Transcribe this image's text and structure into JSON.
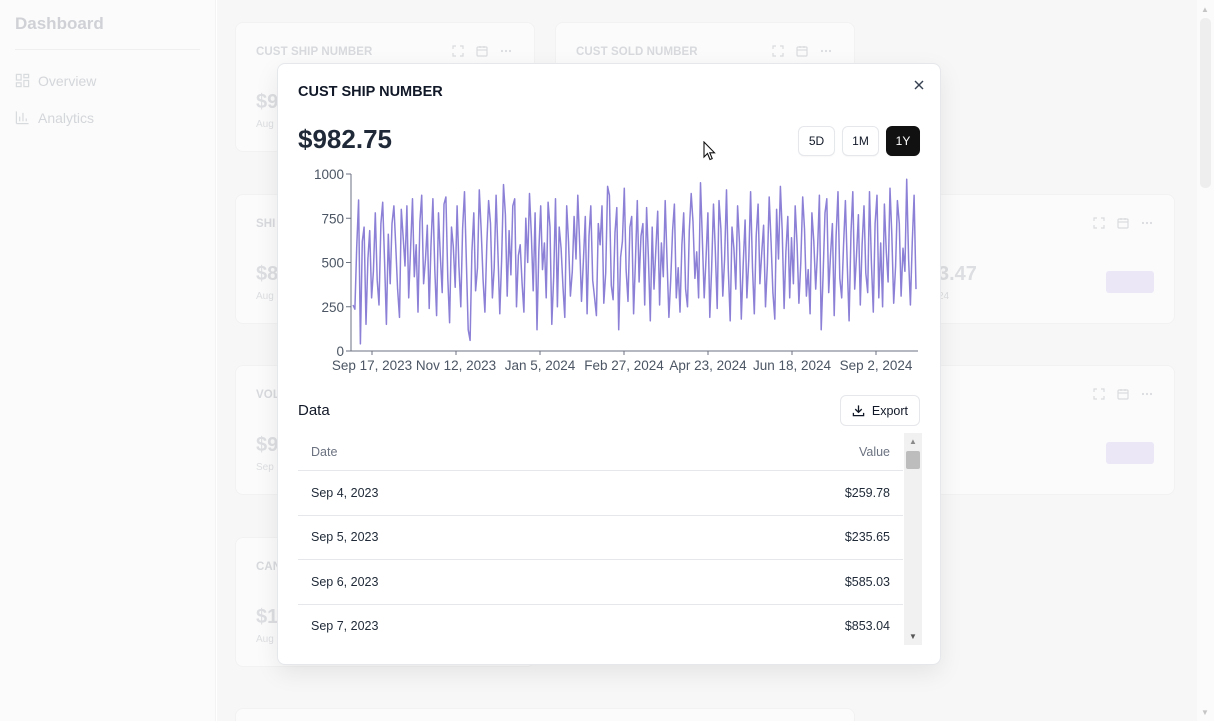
{
  "sidebar": {
    "title": "Dashboard",
    "items": [
      {
        "label": "Overview",
        "icon": "grid-icon"
      },
      {
        "label": "Analytics",
        "icon": "bar-chart-icon"
      }
    ]
  },
  "background_cards": [
    {
      "title": "CUST SHIP NUMBER",
      "value": "$9",
      "sub": "Aug"
    },
    {
      "title": "CUST SOLD NUMBER"
    },
    {
      "title": "SHI",
      "value": "$8",
      "sub": "Aug"
    },
    {
      "title": "VOL",
      "value": "$9",
      "sub": "Sep"
    },
    {
      "title": "CAN",
      "value": "$1",
      "sub": "Aug"
    },
    {
      "value_right": "3.47",
      "sub_right": "24"
    }
  ],
  "modal": {
    "title": "CUST SHIP NUMBER",
    "close_label": "×",
    "value": "$982.75",
    "ranges": [
      "5D",
      "1M",
      "1Y"
    ],
    "active_range": "1Y",
    "data_title": "Data",
    "export_label": "Export",
    "table": {
      "headers": [
        "Date",
        "Value"
      ],
      "rows": [
        [
          "Sep 4, 2023",
          "$259.78"
        ],
        [
          "Sep 5, 2023",
          "$235.65"
        ],
        [
          "Sep 6, 2023",
          "$585.03"
        ],
        [
          "Sep 7, 2023",
          "$853.04"
        ]
      ]
    }
  },
  "colors": {
    "line": "#8b80d6",
    "active_button": "#111111",
    "spark": "#e6e2f6"
  },
  "chart_data": {
    "type": "line",
    "title": "",
    "xlabel": "",
    "ylabel": "",
    "ylim": [
      0,
      1000
    ],
    "yticks": [
      0,
      250,
      500,
      750,
      1000
    ],
    "xtick_labels": [
      "Sep 17, 2023",
      "Nov 12, 2023",
      "Jan 5, 2024",
      "Feb 27, 2024",
      "Apr 23, 2024",
      "Jun 18, 2024",
      "Sep 2, 2024"
    ],
    "x_start": "Sep 4, 2023",
    "x_end": "Sep 6, 2024",
    "series": [
      {
        "values": [
          260,
          236,
          585,
          853,
          40,
          620,
          700,
          150,
          520,
          680,
          300,
          450,
          780,
          400,
          260,
          720,
          840,
          500,
          150,
          660,
          380,
          720,
          820,
          600,
          350,
          190,
          800,
          640,
          480,
          820,
          300,
          580,
          860,
          420,
          600,
          220,
          730,
          880,
          380,
          520,
          710,
          240,
          600,
          860,
          460,
          200,
          780,
          540,
          330,
          830,
          870,
          410,
          160,
          700,
          590,
          360,
          820,
          480,
          250,
          690,
          900,
          520,
          120,
          60,
          560,
          780,
          340,
          470,
          910,
          680,
          400,
          220,
          600,
          850,
          720,
          300,
          470,
          880,
          560,
          210,
          510,
          940,
          770,
          310,
          680,
          430,
          820,
          860,
          250,
          540,
          600,
          380,
          220,
          750,
          500,
          890,
          650,
          340,
          780,
          120,
          560,
          820,
          460,
          610,
          300,
          840,
          700,
          150,
          420,
          860,
          250,
          700,
          580,
          360,
          190,
          820,
          620,
          310,
          450,
          760,
          520,
          880,
          600,
          280,
          510,
          760,
          210,
          650,
          820,
          400,
          300,
          200,
          720,
          600,
          820,
          270,
          440,
          930,
          880,
          370,
          290,
          670,
          810,
          120,
          530,
          620,
          920,
          460,
          280,
          700,
          760,
          210,
          500,
          850,
          390,
          650,
          720,
          260,
          810,
          530,
          170,
          700,
          350,
          580,
          790,
          260,
          610,
          420,
          850,
          520,
          190,
          400,
          680,
          830,
          300,
          470,
          220,
          600,
          780,
          350,
          250,
          680,
          890,
          730,
          410,
          560,
          300,
          950,
          640,
          300,
          520,
          780,
          190,
          460,
          830,
          570,
          240,
          850,
          690,
          310,
          520,
          910,
          460,
          170,
          700,
          580,
          350,
          820,
          610,
          180,
          490,
          740,
          300,
          520,
          900,
          470,
          210,
          650,
          830,
          380,
          560,
          710,
          250,
          490,
          870,
          610,
          330,
          180,
          800,
          520,
          930,
          680,
          240,
          560,
          760,
          300,
          640,
          380,
          820,
          600,
          270,
          500,
          870,
          690,
          310,
          460,
          210,
          780,
          620,
          350,
          560,
          880,
          120,
          430,
          780,
          860,
          330,
          540,
          720,
          200,
          650,
          900,
          410,
          300,
          590,
          850,
          480,
          170,
          670,
          900,
          350,
          540,
          770,
          260,
          600,
          820,
          440,
          330,
          900,
          500,
          220,
          720,
          880,
          300,
          610,
          250,
          830,
          560,
          390,
          920,
          660,
          270,
          480,
          850,
          720,
          310,
          580,
          450,
          970,
          520,
          260,
          620,
          880,
          350
        ]
      }
    ]
  }
}
